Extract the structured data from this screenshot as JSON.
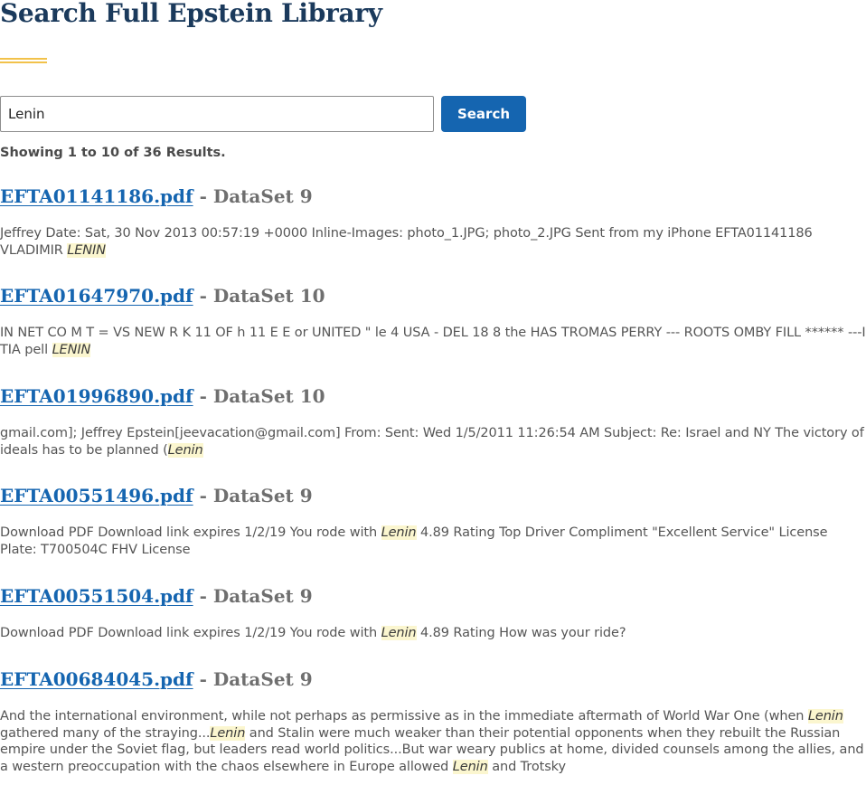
{
  "page": {
    "title": "Search Full Epstein Library",
    "accent_color": "#f2c24b",
    "link_color": "#1565b0",
    "highlight_color": "#fbf6cf"
  },
  "search": {
    "query": "Lenin",
    "button_label": "Search"
  },
  "results_summary": "Showing 1 to 10 of 36 Results.",
  "results": [
    {
      "file": "EFTA01141186.pdf",
      "separator": "-",
      "dataset": "DataSet 9",
      "snippet": [
        {
          "text": "Jeffrey Date: Sat, 30 Nov 2013 00:57:19 +0000 Inline-Images: photo_1.JPG; photo_2.JPG Sent from my iPhone EFTA01141186 VLADIMIR "
        },
        {
          "text": "LENIN",
          "highlight": true
        }
      ]
    },
    {
      "file": "EFTA01647970.pdf",
      "separator": "-",
      "dataset": "DataSet 10",
      "snippet": [
        {
          "text": "IN NET CO M T = VS NEW R K 11 OF h 11 E E or UNITED \" le 4 USA - DEL 18 8 the HAS TROMAS PERRY --- ROOTS OMBY FILL ****** ---I TIA pell "
        },
        {
          "text": "LENIN",
          "highlight": true
        }
      ]
    },
    {
      "file": "EFTA01996890.pdf",
      "separator": "-",
      "dataset": "DataSet 10",
      "snippet": [
        {
          "text": "gmail.com]; Jeffrey Epstein[jeevacation@gmail.com] From: Sent: Wed 1/5/2011 11:26:54 AM Subject: Re: Israel and NY The victory of ideals has to be planned ("
        },
        {
          "text": "Lenin",
          "highlight": true
        }
      ]
    },
    {
      "file": "EFTA00551496.pdf",
      "separator": "-",
      "dataset": "DataSet 9",
      "snippet": [
        {
          "text": "Download PDF Download link expires 1/2/19 You rode with "
        },
        {
          "text": "Lenin",
          "highlight": true
        },
        {
          "text": " 4.89 Rating Top Driver Compliment \"Excellent Service\" License Plate: T700504C FHV License"
        }
      ]
    },
    {
      "file": "EFTA00551504.pdf",
      "separator": "-",
      "dataset": "DataSet 9",
      "snippet": [
        {
          "text": "Download PDF Download link expires 1/2/19 You rode with "
        },
        {
          "text": "Lenin",
          "highlight": true
        },
        {
          "text": " 4.89 Rating How was your ride?"
        }
      ]
    },
    {
      "file": "EFTA00684045.pdf",
      "separator": "-",
      "dataset": "DataSet 9",
      "snippet": [
        {
          "text": "And the international environment, while not perhaps as permissive as in the immediate aftermath of World War One (when "
        },
        {
          "text": "Lenin",
          "highlight": true
        },
        {
          "text": " gathered many of the straying..."
        },
        {
          "text": "Lenin",
          "highlight": true
        },
        {
          "text": " and Stalin were much weaker than their potential opponents when they rebuilt the Russian empire under the Soviet flag, but leaders read world politics...But war weary publics at home, divided counsels among the allies, and a western preoccupation with the chaos elsewhere in Europe allowed "
        },
        {
          "text": "Lenin",
          "highlight": true
        },
        {
          "text": " and Trotsky"
        }
      ]
    }
  ]
}
